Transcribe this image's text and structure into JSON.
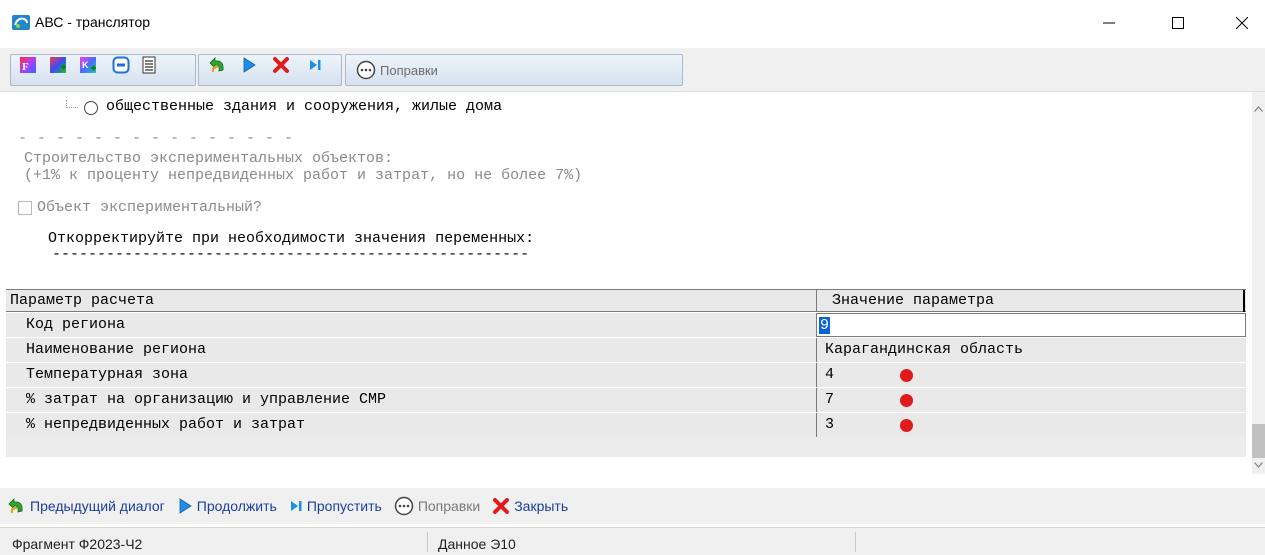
{
  "window": {
    "title": "АВС - транслятор",
    "controls": {
      "minimize": "minimize-icon",
      "maximize": "maximize-icon",
      "close": "close-icon"
    }
  },
  "toolbar": {
    "icons": [
      "formula-icon",
      "add-resource-icon",
      "add-k-icon",
      "minus-icon",
      "document-icon",
      "previous-icon",
      "play-icon",
      "close-x-icon",
      "skip-icon"
    ],
    "popravki_label": "Поправки"
  },
  "content": {
    "radio_option": "общественные здания и сооружения, жилые дома",
    "dashes_line": "- - - - - - - - - - - - - - -",
    "experimental_heading": "Строительство экспериментальных объектов:",
    "experimental_note": "(+1% к проценту непредвиденных работ и затрат, но не более 7%)",
    "experimental_checkbox": "Объект экспериментальный?",
    "correct_prompt": "Откорректируйте при необходимости значения переменных:",
    "underline": "-----------------------------------------------------"
  },
  "grid": {
    "headers": {
      "param": "Параметр расчета",
      "value": "Значение параметра"
    },
    "rows": [
      {
        "name": "Код региона",
        "value": "9",
        "editing": true
      },
      {
        "name": "Наименование региона",
        "value": "Карагандинская область"
      },
      {
        "name": "Температурная зона",
        "value": "4",
        "dot": true
      },
      {
        "name": "% затрат на организацию и управление СМР",
        "value": "7",
        "dot": true
      },
      {
        "name": "% непредвиденных работ и затрат",
        "value": "3",
        "dot": true
      }
    ]
  },
  "actions": {
    "prev": "Предыдущий диалог",
    "next": "Продолжить",
    "skip": "Пропустить",
    "popravki": "Поправки",
    "close": "Закрыть"
  },
  "status": {
    "fragment": "Фрагмент Ф2023-Ч2",
    "data": "Данное Э10"
  },
  "colors": {
    "accent_blue": "#0a64d2",
    "dot_red": "#e01b1b",
    "close_red": "#e01b1b",
    "link_blue": "#1a3e9c"
  }
}
